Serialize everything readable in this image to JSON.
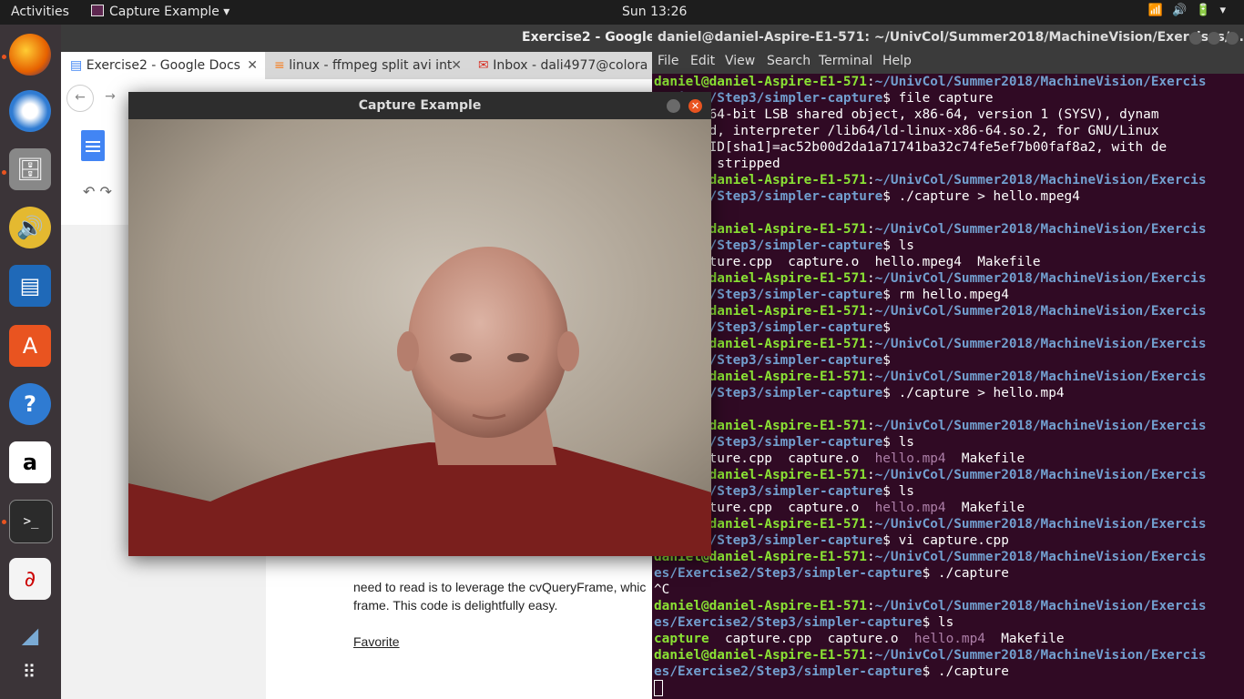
{
  "topbar": {
    "activities": "Activities",
    "app_name": "Capture Example",
    "clock": "Sun 13:26",
    "status_icons": "wifi-icon volume-icon battery-icon power-icon"
  },
  "dock": {
    "items": [
      "firefox-icon",
      "thunderbird-icon",
      "files-icon",
      "rhythmbox-icon",
      "writer-icon",
      "software-icon",
      "help-icon",
      "amazon-icon",
      "terminal-icon",
      "evince-icon",
      "shotwell-icon",
      "apps-grid-icon"
    ]
  },
  "browser": {
    "window_title": "Exercise2 - Google D",
    "tabs": [
      {
        "label": "Exercise2 - Google Docs"
      },
      {
        "label": "linux - ffmpeg split avi int"
      },
      {
        "label": "Inbox - dali4977@colora"
      }
    ],
    "doc_text": [
      "need to read is to leverage the cvQueryFrame, whic",
      "frame. This code is delightfully easy."
    ],
    "doc_link": "Favorite"
  },
  "terminal": {
    "window_title": "daniel@daniel-Aspire-E1-571: ~/UnivCol/Summer2018/MachineVision/Exercises/...",
    "menu": [
      "File",
      "Edit",
      "View",
      "Search",
      "Terminal",
      "Help"
    ],
    "lines": [
      [
        {
          "t": "daniel@daniel-Aspire-E1-571",
          "c": "pu"
        },
        {
          "t": ":"
        },
        {
          "t": "~/UnivCol/Summer2018/MachineVision/Exercis",
          "c": "pp"
        }
      ],
      [
        {
          "t": "ercise2/Step3/simpler-capture",
          "c": "pp"
        },
        {
          "t": "$ file capture"
        }
      ],
      [
        {
          "t": "e: ELF 64-bit LSB shared object, x86-64, version 1 (SYSV), dynam"
        }
      ],
      [
        {
          "t": "y linked, interpreter /lib64/ld-linux-x86-64.so.2, for GNU/Linux"
        }
      ],
      [
        {
          "t": ", BuildID[sha1]=ac52b00d2da1a71741ba32c74fe5ef7b00faf8a2, with de"
        }
      ],
      [
        {
          "t": "fo, not stripped"
        }
      ],
      [
        {
          "t": "daniel@daniel-Aspire-E1-571",
          "c": "pu"
        },
        {
          "t": ":"
        },
        {
          "t": "~/UnivCol/Summer2018/MachineVision/Exercis",
          "c": "pp"
        }
      ],
      [
        {
          "t": "ercise2/Step3/simpler-capture",
          "c": "pp"
        },
        {
          "t": "$ ./capture > hello.mpeg4"
        }
      ],
      [
        {
          "t": ""
        }
      ],
      [
        {
          "t": "daniel@daniel-Aspire-E1-571",
          "c": "pu"
        },
        {
          "t": ":"
        },
        {
          "t": "~/UnivCol/Summer2018/MachineVision/Exercis",
          "c": "pp"
        }
      ],
      [
        {
          "t": "ercise2/Step3/simpler-capture",
          "c": "pp"
        },
        {
          "t": "$ ls"
        }
      ],
      [
        {
          "t": "re  capture.cpp  capture.o  hello.mpeg4  Makefile"
        }
      ],
      [
        {
          "t": "daniel@daniel-Aspire-E1-571",
          "c": "pu"
        },
        {
          "t": ":"
        },
        {
          "t": "~/UnivCol/Summer2018/MachineVision/Exercis",
          "c": "pp"
        }
      ],
      [
        {
          "t": "ercise2/Step3/simpler-capture",
          "c": "pp"
        },
        {
          "t": "$ rm hello.mpeg4"
        }
      ],
      [
        {
          "t": "daniel@daniel-Aspire-E1-571",
          "c": "pu"
        },
        {
          "t": ":"
        },
        {
          "t": "~/UnivCol/Summer2018/MachineVision/Exercis",
          "c": "pp"
        }
      ],
      [
        {
          "t": "ercise2/Step3/simpler-capture",
          "c": "pp"
        },
        {
          "t": "$"
        }
      ],
      [
        {
          "t": "daniel@daniel-Aspire-E1-571",
          "c": "pu"
        },
        {
          "t": ":"
        },
        {
          "t": "~/UnivCol/Summer2018/MachineVision/Exercis",
          "c": "pp"
        }
      ],
      [
        {
          "t": "ercise2/Step3/simpler-capture",
          "c": "pp"
        },
        {
          "t": "$"
        }
      ],
      [
        {
          "t": "daniel@daniel-Aspire-E1-571",
          "c": "pu"
        },
        {
          "t": ":"
        },
        {
          "t": "~/UnivCol/Summer2018/MachineVision/Exercis",
          "c": "pp"
        }
      ],
      [
        {
          "t": "ercise2/Step3/simpler-capture",
          "c": "pp"
        },
        {
          "t": "$ ./capture > hello.mp4"
        }
      ],
      [
        {
          "t": ""
        }
      ],
      [
        {
          "t": "daniel@daniel-Aspire-E1-571",
          "c": "pu"
        },
        {
          "t": ":"
        },
        {
          "t": "~/UnivCol/Summer2018/MachineVision/Exercis",
          "c": "pp"
        }
      ],
      [
        {
          "t": "ercise2/Step3/simpler-capture",
          "c": "pp"
        },
        {
          "t": "$ ls"
        }
      ],
      [
        {
          "t": "re  capture.cpp  capture.o  "
        },
        {
          "t": "hello.mp4",
          "c": "mp"
        },
        {
          "t": "  Makefile"
        }
      ],
      [
        {
          "t": "daniel@daniel-Aspire-E1-571",
          "c": "pu"
        },
        {
          "t": ":"
        },
        {
          "t": "~/UnivCol/Summer2018/MachineVision/Exercis",
          "c": "pp"
        }
      ],
      [
        {
          "t": "ercise2/Step3/simpler-capture",
          "c": "pp"
        },
        {
          "t": "$ ls"
        }
      ],
      [
        {
          "t": "re  capture.cpp  capture.o  "
        },
        {
          "t": "hello.mp4",
          "c": "mp"
        },
        {
          "t": "  Makefile"
        }
      ],
      [
        {
          "t": "daniel@daniel-Aspire-E1-571",
          "c": "pu"
        },
        {
          "t": ":"
        },
        {
          "t": "~/UnivCol/Summer2018/MachineVision/Exercis",
          "c": "pp"
        }
      ],
      [
        {
          "t": "ercise2/Step3/simpler-capture",
          "c": "pp"
        },
        {
          "t": "$ vi capture.cpp"
        }
      ],
      [
        {
          "t": "daniel@daniel-Aspire-E1-571",
          "c": "pu"
        },
        {
          "t": ":"
        },
        {
          "t": "~/UnivCol/Summer2018/MachineVision/Exercis",
          "c": "pp"
        }
      ],
      [
        {
          "t": "es/Exercise2/Step3/simpler-capture",
          "c": "pp"
        },
        {
          "t": "$ ./capture"
        }
      ],
      [
        {
          "t": "^C"
        }
      ],
      [
        {
          "t": "daniel@daniel-Aspire-E1-571",
          "c": "pu"
        },
        {
          "t": ":"
        },
        {
          "t": "~/UnivCol/Summer2018/MachineVision/Exercis",
          "c": "pp"
        }
      ],
      [
        {
          "t": "es/Exercise2/Step3/simpler-capture",
          "c": "pp"
        },
        {
          "t": "$ ls"
        }
      ],
      [
        {
          "t": "capture",
          "c": "ex"
        },
        {
          "t": "  capture.cpp  capture.o  "
        },
        {
          "t": "hello.mp4",
          "c": "mp"
        },
        {
          "t": "  Makefile"
        }
      ],
      [
        {
          "t": "daniel@daniel-Aspire-E1-571",
          "c": "pu"
        },
        {
          "t": ":"
        },
        {
          "t": "~/UnivCol/Summer2018/MachineVision/Exercis",
          "c": "pp"
        }
      ],
      [
        {
          "t": "es/Exercise2/Step3/simpler-capture",
          "c": "pp"
        },
        {
          "t": "$ ./capture"
        }
      ]
    ]
  },
  "capture_window": {
    "title": "Capture Example",
    "image_desc_icon": "webcam-frame"
  }
}
